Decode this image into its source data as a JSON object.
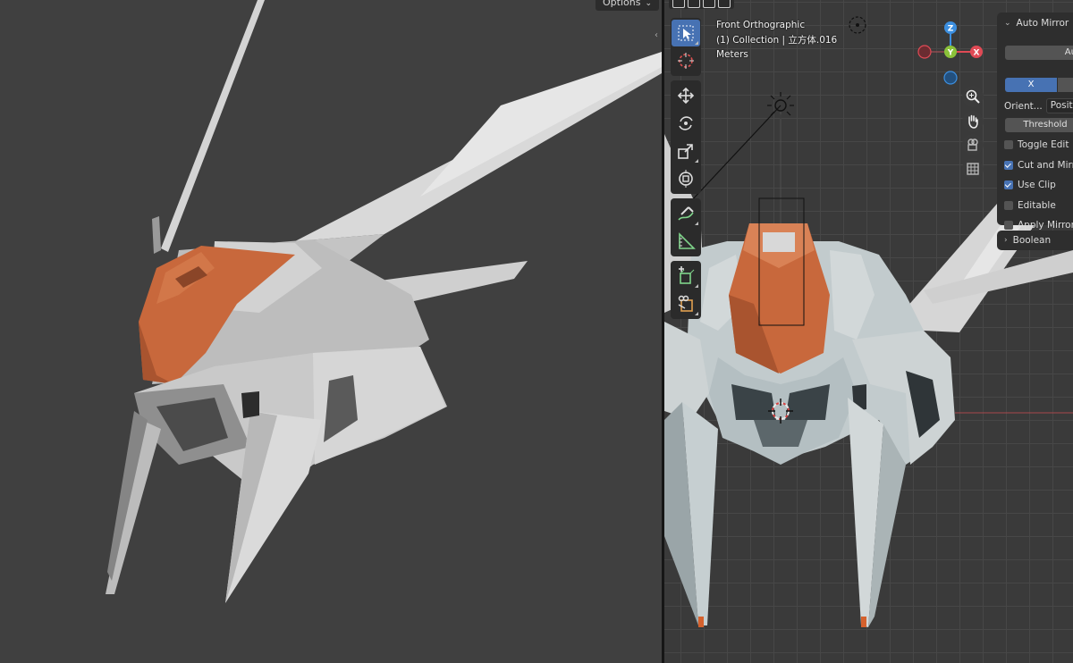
{
  "left_viewport": {
    "options_label": "Options",
    "options_chevron": "⌄"
  },
  "right_viewport": {
    "view_name": "Front Orthographic",
    "collection_info": "(1) Collection | 立方体.016",
    "units": "Meters",
    "gizmo": {
      "z": "Z",
      "y": "Y",
      "x": "X"
    },
    "toolbar_tools": [
      "select-box",
      "cursor",
      "move",
      "rotate",
      "scale",
      "transform",
      "annotate",
      "measure",
      "add-cube",
      "shear"
    ],
    "nav_buttons": [
      "zoom",
      "pan",
      "camera",
      "grid"
    ]
  },
  "auto_mirror_panel": {
    "title": "Auto Mirror",
    "auto_button": "Auto",
    "axis_x": "X",
    "orientation_label": "Orient...",
    "orientation_value": "Positive",
    "threshold_label": "Threshold",
    "checkboxes": [
      {
        "label": "Toggle Edit",
        "checked": false
      },
      {
        "label": "Cut and Mirror",
        "checked": true
      },
      {
        "label": "Use Clip",
        "checked": true
      },
      {
        "label": "Editable",
        "checked": false
      },
      {
        "label": "Apply Mirror",
        "checked": false
      }
    ]
  },
  "boolean_panel": {
    "title": "Boolean"
  },
  "colors": {
    "accent": "#4772b3",
    "model_orange": "#c8683c",
    "model_white": "#dcdcdc",
    "gizmo_x": "#e04a55",
    "gizmo_y": "#8bc23a",
    "gizmo_z": "#3c8fe0"
  }
}
